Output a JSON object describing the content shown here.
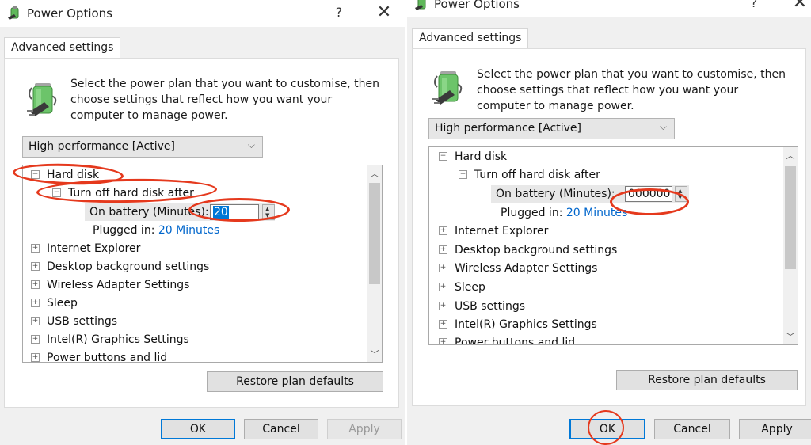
{
  "dialogs": [
    {
      "title": "Power Options",
      "help_label": "?",
      "close_label": "✕",
      "tab_label": "Advanced settings",
      "description": "Select the power plan that you want to customise, then choose settings that reflect how you want your computer to manage power.",
      "plan_select": {
        "value": "High performance [Active]",
        "chevron": "⌵"
      },
      "tree": {
        "hard_disk": {
          "expander": "−",
          "label": "Hard disk"
        },
        "turn_off": {
          "expander": "−",
          "label": "Turn off hard disk after"
        },
        "on_battery": {
          "label": "On battery (Minutes):",
          "value": "20"
        },
        "plugged_in": {
          "label": "Plugged in:",
          "value": "20 Minutes"
        },
        "items": [
          {
            "expander": "+",
            "label": "Internet Explorer"
          },
          {
            "expander": "+",
            "label": "Desktop background settings"
          },
          {
            "expander": "+",
            "label": "Wireless Adapter Settings"
          },
          {
            "expander": "+",
            "label": "Sleep"
          },
          {
            "expander": "+",
            "label": "USB settings"
          },
          {
            "expander": "+",
            "label": "Intel(R) Graphics Settings"
          },
          {
            "expander": "+",
            "label": "Power buttons and lid"
          }
        ]
      },
      "restore_label": "Restore plan defaults",
      "ok_label": "OK",
      "cancel_label": "Cancel",
      "apply_label": "Apply",
      "apply_enabled": false
    },
    {
      "title": "Power Options",
      "help_label": "?",
      "close_label": "✕",
      "tab_label": "Advanced settings",
      "description": "Select the power plan that you want to customise, then choose settings that reflect how you want your computer to manage power.",
      "plan_select": {
        "value": "High performance [Active]",
        "chevron": "⌵"
      },
      "tree": {
        "hard_disk": {
          "expander": "−",
          "label": "Hard disk"
        },
        "turn_off": {
          "expander": "−",
          "label": "Turn off hard disk after"
        },
        "on_battery": {
          "label": "On battery (Minutes):",
          "value": "000000"
        },
        "plugged_in": {
          "label": "Plugged in:",
          "value": "20 Minutes"
        },
        "items": [
          {
            "expander": "+",
            "label": "Internet Explorer"
          },
          {
            "expander": "+",
            "label": "Desktop background settings"
          },
          {
            "expander": "+",
            "label": "Wireless Adapter Settings"
          },
          {
            "expander": "+",
            "label": "Sleep"
          },
          {
            "expander": "+",
            "label": "USB settings"
          },
          {
            "expander": "+",
            "label": "Intel(R) Graphics Settings"
          },
          {
            "expander": "+",
            "label": "Power buttons and lid"
          }
        ]
      },
      "restore_label": "Restore plan defaults",
      "ok_label": "OK",
      "cancel_label": "Cancel",
      "apply_label": "Apply",
      "apply_enabled": true
    }
  ],
  "annotation_color": "#e5391d",
  "accent_color": "#0078d7",
  "link_color": "#0066cc"
}
